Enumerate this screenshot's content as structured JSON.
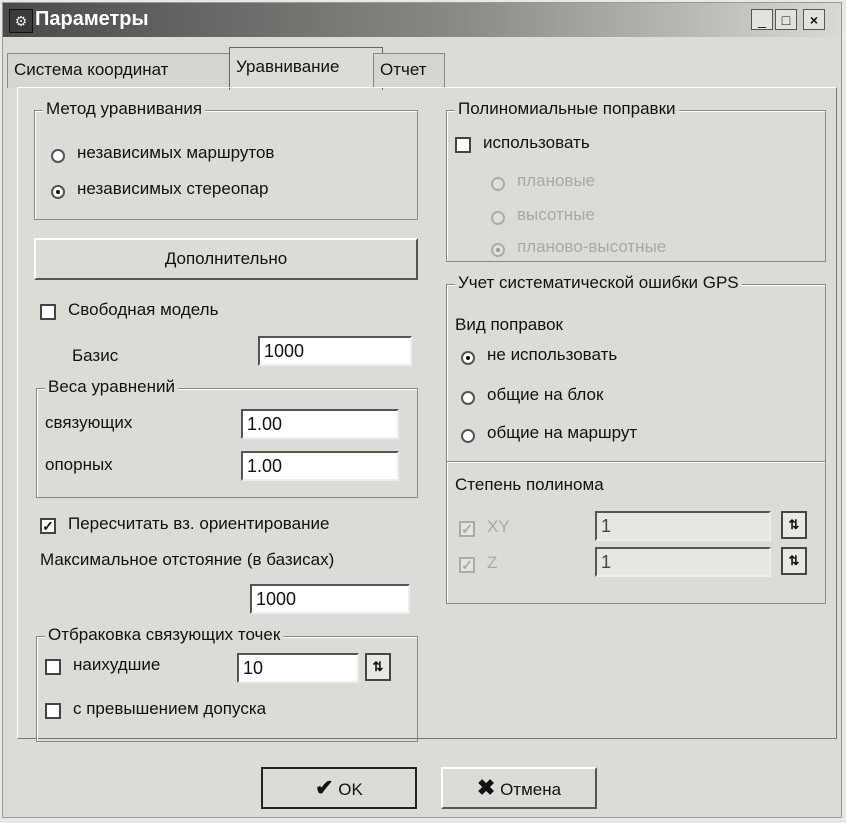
{
  "window": {
    "title": "Параметры",
    "icon": "app-icon",
    "minimize": "_",
    "maximize": "□",
    "close": "×"
  },
  "tabs": [
    {
      "label": "Система координат"
    },
    {
      "label": "Уравнивание",
      "active": true
    },
    {
      "label": "Отчет"
    }
  ],
  "method": {
    "title": "Метод уравнивания",
    "options": [
      {
        "label": "независимых маршрутов",
        "selected": false
      },
      {
        "label": "независимых стереопар",
        "selected": true
      }
    ]
  },
  "extra_button": "Дополнительно",
  "free_model": {
    "label": "Свободная модель",
    "checked": false
  },
  "basis": {
    "label": "Базис",
    "value": "1000"
  },
  "weights": {
    "title": "Веса уравнений",
    "tie_label": "связующих",
    "tie_value": "1.00",
    "control_label": "опорных",
    "control_value": "1.00"
  },
  "recalc": {
    "label": "Пересчитать вз. ориентирование",
    "checked": true
  },
  "max_dist": {
    "label": "Максимальное отстояние (в базисах)",
    "value": "1000"
  },
  "reject": {
    "title": "Отбраковка связующих точек",
    "worst_label": "наихудшие",
    "worst_checked": false,
    "worst_value": "10",
    "tol_label": "с превышением допуска",
    "tol_checked": false
  },
  "poly": {
    "title": "Полиномиальные поправки",
    "use_label": "использовать",
    "use_checked": false,
    "options": [
      {
        "label": "плановые",
        "selected": false
      },
      {
        "label": "высотные",
        "selected": false
      },
      {
        "label": "планово-высотные",
        "selected": true
      }
    ]
  },
  "gps": {
    "title": "Учет систематической ошибки GPS",
    "kind_label": "Вид поправок",
    "options": [
      {
        "label": "не использовать",
        "selected": true
      },
      {
        "label": "общие на блок",
        "selected": false
      },
      {
        "label": "общие на маршрут",
        "selected": false
      }
    ],
    "degree_label": "Степень полинома",
    "xy_label": "XY",
    "xy_value": "1",
    "z_label": "Z",
    "z_value": "1"
  },
  "buttons": {
    "ok": "OK",
    "cancel": "Отмена"
  },
  "colors": {
    "ok_check": "#1a1a1a",
    "cancel_x": "#111111"
  }
}
